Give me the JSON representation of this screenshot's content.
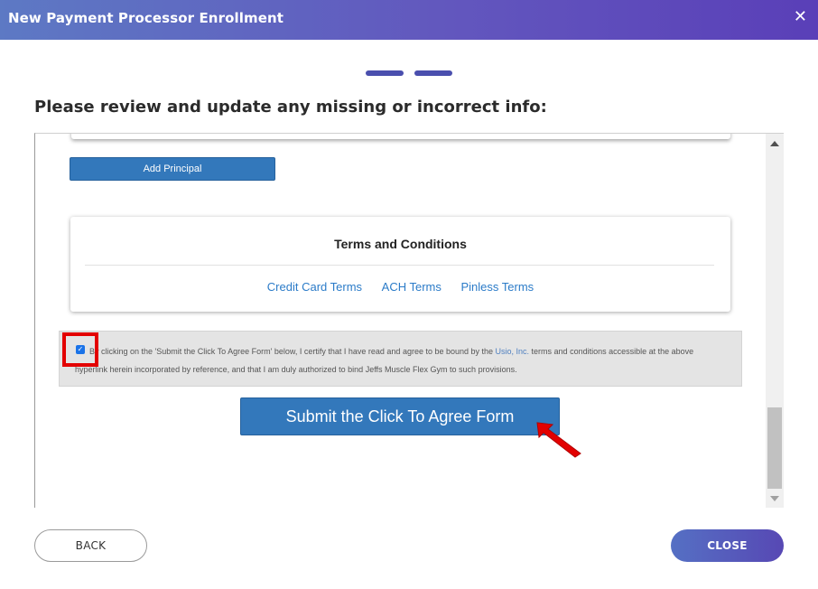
{
  "dialog": {
    "title": "New Payment Processor Enrollment",
    "close_glyph": "✕"
  },
  "stepper": {
    "steps_total": 2,
    "active_steps": 2
  },
  "heading": "Please review and update any missing or incorrect info:",
  "principal": {
    "add_label": "Add Principal"
  },
  "terms": {
    "title": "Terms and Conditions",
    "links": [
      "Credit Card Terms",
      "ACH Terms",
      "Pinless Terms"
    ]
  },
  "agreement": {
    "checked": true,
    "text_before": "By clicking on the 'Submit the Click To Agree Form' below, I certify that I have read and agree to be bound by the ",
    "company_link": "Usio, Inc.",
    "text_after": " terms and conditions accessible at the above hyperlink herein incorporated by reference, and that I am duly authorized to bind Jeffs Muscle Flex Gym to such provisions."
  },
  "submit": {
    "label": "Submit the Click To Agree Form"
  },
  "footer": {
    "back_label": "BACK",
    "close_label": "CLOSE"
  },
  "colors": {
    "header_gradient_start": "#5d79c4",
    "header_gradient_end": "#5a3fb8",
    "primary_button": "#3378bb",
    "link": "#2b7bc8",
    "highlight": "#e30000"
  }
}
